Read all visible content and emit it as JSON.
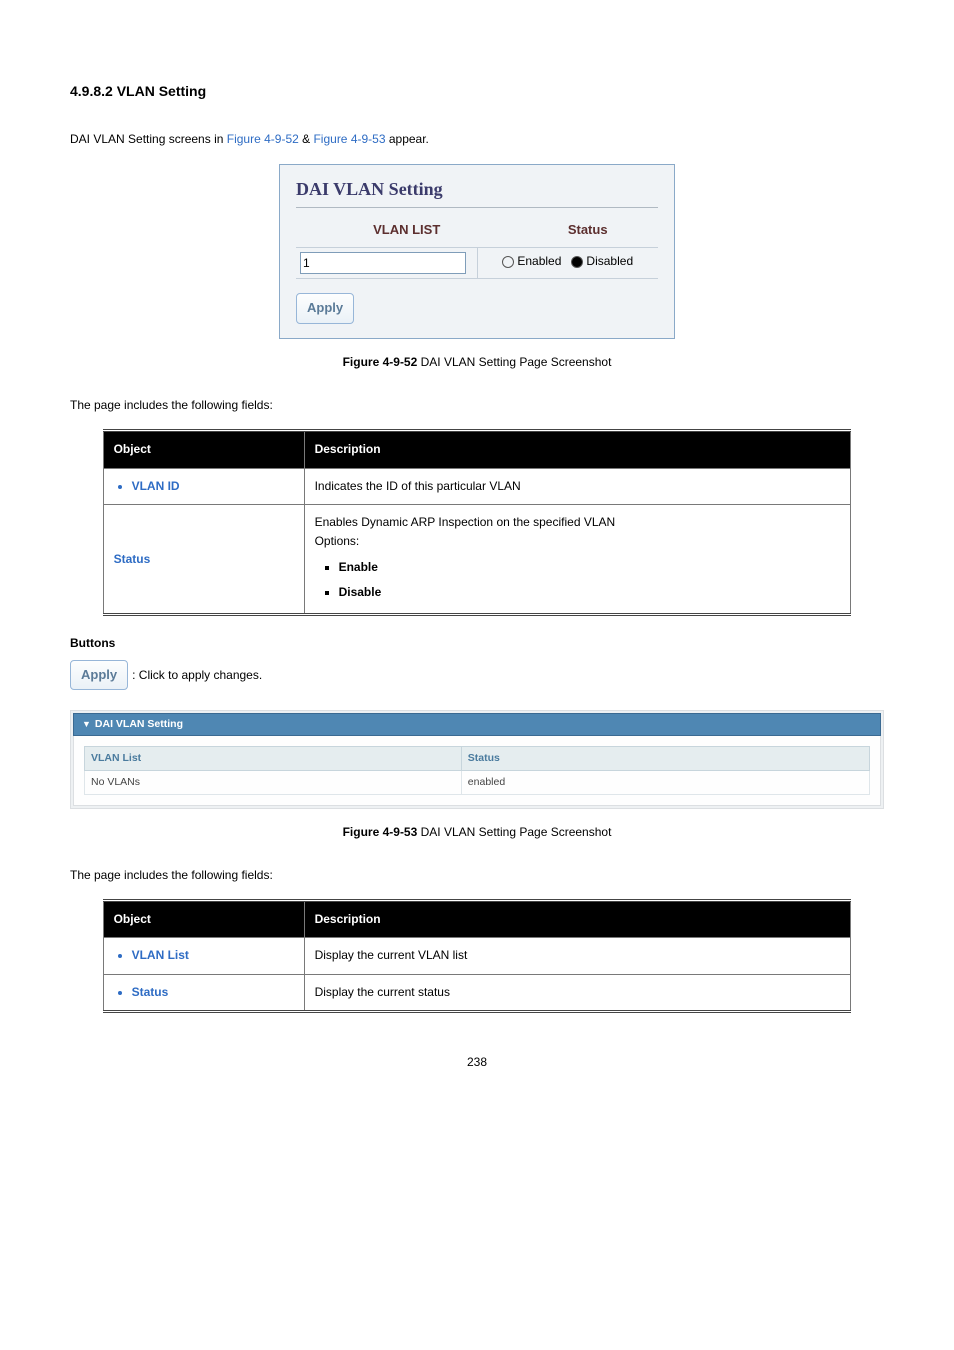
{
  "section": {
    "heading": "4.9.8.2 VLAN Setting"
  },
  "intro": {
    "prefix": "DAI VLAN Setting screens in ",
    "link1": "Figure 4-9-52",
    "amp": " & ",
    "link2": "Figure 4-9-53",
    "suffix": " appear."
  },
  "fig1": {
    "title": "DAI VLAN Setting",
    "col1": "VLAN LIST",
    "col2": "Status",
    "input_value": "1",
    "opt_enabled": "Enabled",
    "opt_disabled": "Disabled",
    "apply": "Apply"
  },
  "caption1": {
    "bold": "Figure 4-9-52",
    "rest": " DAI VLAN Setting Page Screenshot"
  },
  "fields_intro": "The page includes the following fields:",
  "table1": {
    "h1": "Object",
    "h2": "Description",
    "r1_obj": "VLAN ID",
    "r1_desc": "Indicates the ID of this particular VLAN",
    "r2_obj": "Status",
    "r2_desc_line1": "Enables Dynamic ARP Inspection on the specified VLAN",
    "r2_desc_line2": "Options:",
    "r2_opt1": "Enable",
    "r2_opt2": "Disable"
  },
  "buttons": {
    "heading": "Buttons",
    "apply_label": "Apply",
    "apply_desc": ": Click to apply changes."
  },
  "fig2": {
    "bar": "DAI VLAN Setting",
    "col1": "VLAN List",
    "col2": "Status",
    "val1": "No VLANs",
    "val2": "enabled"
  },
  "caption2": {
    "bold": "Figure 4-9-53",
    "rest": " DAI VLAN Setting Page Screenshot"
  },
  "fields_intro2": "The page includes the following fields:",
  "table2": {
    "h1": "Object",
    "h2": "Description",
    "r1_obj": "VLAN List",
    "r1_desc": "Display the current VLAN list",
    "r2_obj": "Status",
    "r2_desc": "Display the current status"
  },
  "page_number": "238"
}
